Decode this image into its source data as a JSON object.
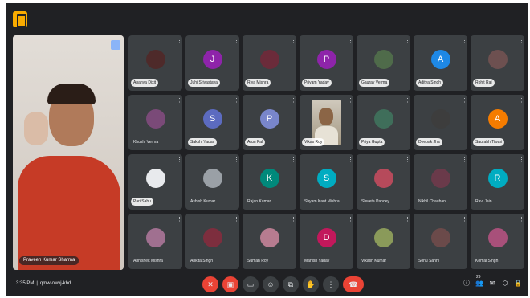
{
  "meeting": {
    "time": "3:35 PM",
    "separator": "|",
    "code": "qmw-owvj-kbd"
  },
  "presenter": {
    "name": "Praveen Kumar Sharma"
  },
  "participants": [
    {
      "name": "Ananya Dixit",
      "initial": "",
      "color": "#4e2a2a",
      "labelStyle": "light"
    },
    {
      "name": "Juhi Srivastava",
      "initial": "J",
      "color": "#8e24aa",
      "labelStyle": "light"
    },
    {
      "name": "Riya Mishra",
      "initial": "",
      "color": "#6b2b3a",
      "labelStyle": "light"
    },
    {
      "name": "Priyam Yadav",
      "initial": "P",
      "color": "#8e24aa",
      "labelStyle": "light"
    },
    {
      "name": "Gaurav Verma",
      "initial": "",
      "color": "#4f6b4a",
      "labelStyle": "light"
    },
    {
      "name": "Aditya Singh",
      "initial": "A",
      "color": "#1e88e5",
      "labelStyle": "light"
    },
    {
      "name": "Rohit Rai",
      "initial": "",
      "color": "#6d5050",
      "labelStyle": "light"
    },
    {
      "name": "Khushi Verma",
      "initial": "",
      "color": "#7a4a78",
      "labelStyle": "dark"
    },
    {
      "name": "Sakshi Yadav",
      "initial": "S",
      "color": "#5c6bc0",
      "labelStyle": "light"
    },
    {
      "name": "Arun Pal",
      "initial": "P",
      "color": "#7986cb",
      "labelStyle": "light"
    },
    {
      "name": "Vikas Roy",
      "initial": "",
      "color": "#3c4043",
      "labelStyle": "light",
      "video": true
    },
    {
      "name": "Priya Gupta",
      "initial": "",
      "color": "#3f6e5a",
      "labelStyle": "light"
    },
    {
      "name": "Deepak Jha",
      "initial": "",
      "color": "#3d3d3d",
      "labelStyle": "light"
    },
    {
      "name": "Saurabh Tiwari",
      "initial": "A",
      "color": "#f57c00",
      "labelStyle": "light"
    },
    {
      "name": "Pari Sahu",
      "initial": "",
      "color": "#e8eaed",
      "labelStyle": "light"
    },
    {
      "name": "Ashish Kumar",
      "initial": "",
      "color": "#9aa0a6",
      "labelStyle": "dark"
    },
    {
      "name": "Rajan Kumar",
      "initial": "K",
      "color": "#00897b",
      "labelStyle": "dark"
    },
    {
      "name": "Shyam Kant Mishra",
      "initial": "S",
      "color": "#00acc1",
      "labelStyle": "dark"
    },
    {
      "name": "Shweta Pandey",
      "initial": "",
      "color": "#b64a5b",
      "labelStyle": "dark"
    },
    {
      "name": "Nikhil Chauhan",
      "initial": "",
      "color": "#6a3a4a",
      "labelStyle": "dark"
    },
    {
      "name": "Ravi Jain",
      "initial": "R",
      "color": "#00acc1",
      "labelStyle": "dark"
    },
    {
      "name": "Abhishek Mishra",
      "initial": "",
      "color": "#a07090",
      "labelStyle": "dark"
    },
    {
      "name": "Ankita Singh",
      "initial": "",
      "color": "#7d2e3e",
      "labelStyle": "dark"
    },
    {
      "name": "Suman Roy",
      "initial": "",
      "color": "#b77c90",
      "labelStyle": "dark"
    },
    {
      "name": "Manish Yadav",
      "initial": "D",
      "color": "#c2185b",
      "labelStyle": "dark"
    },
    {
      "name": "Vikash Kumar",
      "initial": "",
      "color": "#8a9a5a",
      "labelStyle": "dark"
    },
    {
      "name": "Sonu Sahni",
      "initial": "",
      "color": "#6b4a4a",
      "labelStyle": "dark"
    },
    {
      "name": "Komal Singh",
      "initial": "",
      "color": "#a8507a",
      "labelStyle": "dark"
    }
  ],
  "controls": [
    {
      "icon": "mic-off-icon",
      "glyph": "✕",
      "style": "red"
    },
    {
      "icon": "camera-off-icon",
      "glyph": "▣",
      "style": "red"
    },
    {
      "icon": "captions-icon",
      "glyph": "▭",
      "style": "normal"
    },
    {
      "icon": "emoji-icon",
      "glyph": "☺",
      "style": "normal"
    },
    {
      "icon": "present-icon",
      "glyph": "⧉",
      "style": "normal"
    },
    {
      "icon": "raise-hand-icon",
      "glyph": "✋",
      "style": "normal"
    },
    {
      "icon": "more-options-icon",
      "glyph": "⋮",
      "style": "normal"
    },
    {
      "icon": "end-call-icon",
      "glyph": "☎",
      "style": "end"
    }
  ],
  "tools": {
    "info_glyph": "ⓘ",
    "people_glyph": "👥",
    "people_count": "29",
    "chat_glyph": "✉",
    "activities_glyph": "⬡",
    "lock_glyph": "🔒"
  },
  "colors": {
    "background": "#202124",
    "tile": "#3c4043",
    "danger": "#ea4335",
    "accent": "#f9ab00"
  }
}
